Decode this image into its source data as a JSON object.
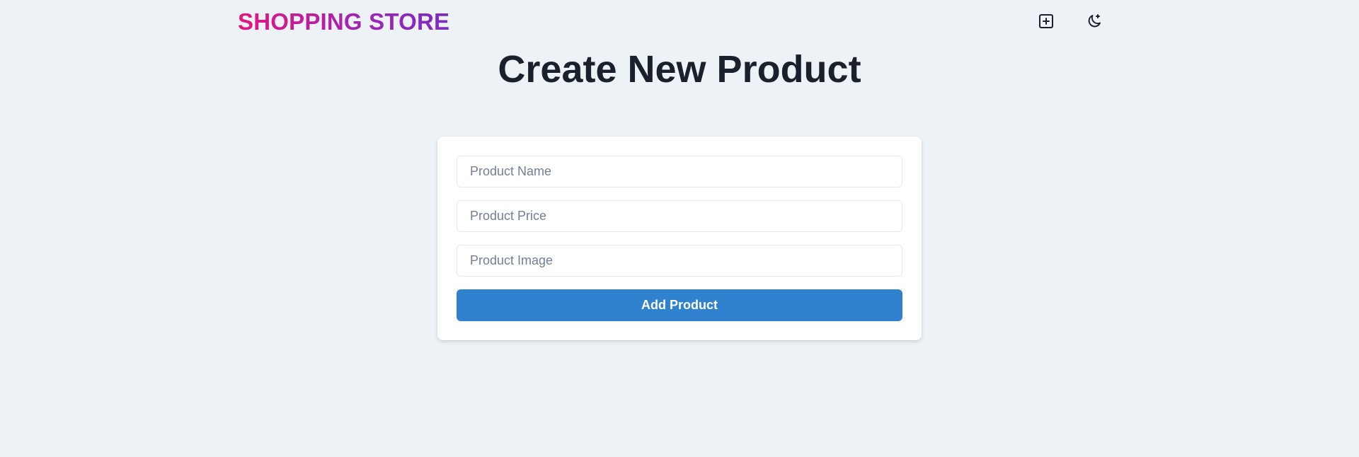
{
  "navbar": {
    "brand": "SHOPPING STORE",
    "actions": [
      {
        "icon": "plus-square-icon"
      },
      {
        "icon": "moon-icon"
      }
    ]
  },
  "page": {
    "title": "Create New Product"
  },
  "form": {
    "name_placeholder": "Product Name",
    "price_placeholder": "Product Price",
    "image_placeholder": "Product Image",
    "name_value": "",
    "price_value": "",
    "image_value": "",
    "submit_label": "Add Product"
  },
  "colors": {
    "background": "#edf2f7",
    "brand_gradient_start": "#e5167d",
    "brand_gradient_end": "#7b2cc1",
    "primary_button": "#3182ce",
    "text_dark": "#1a202c"
  }
}
